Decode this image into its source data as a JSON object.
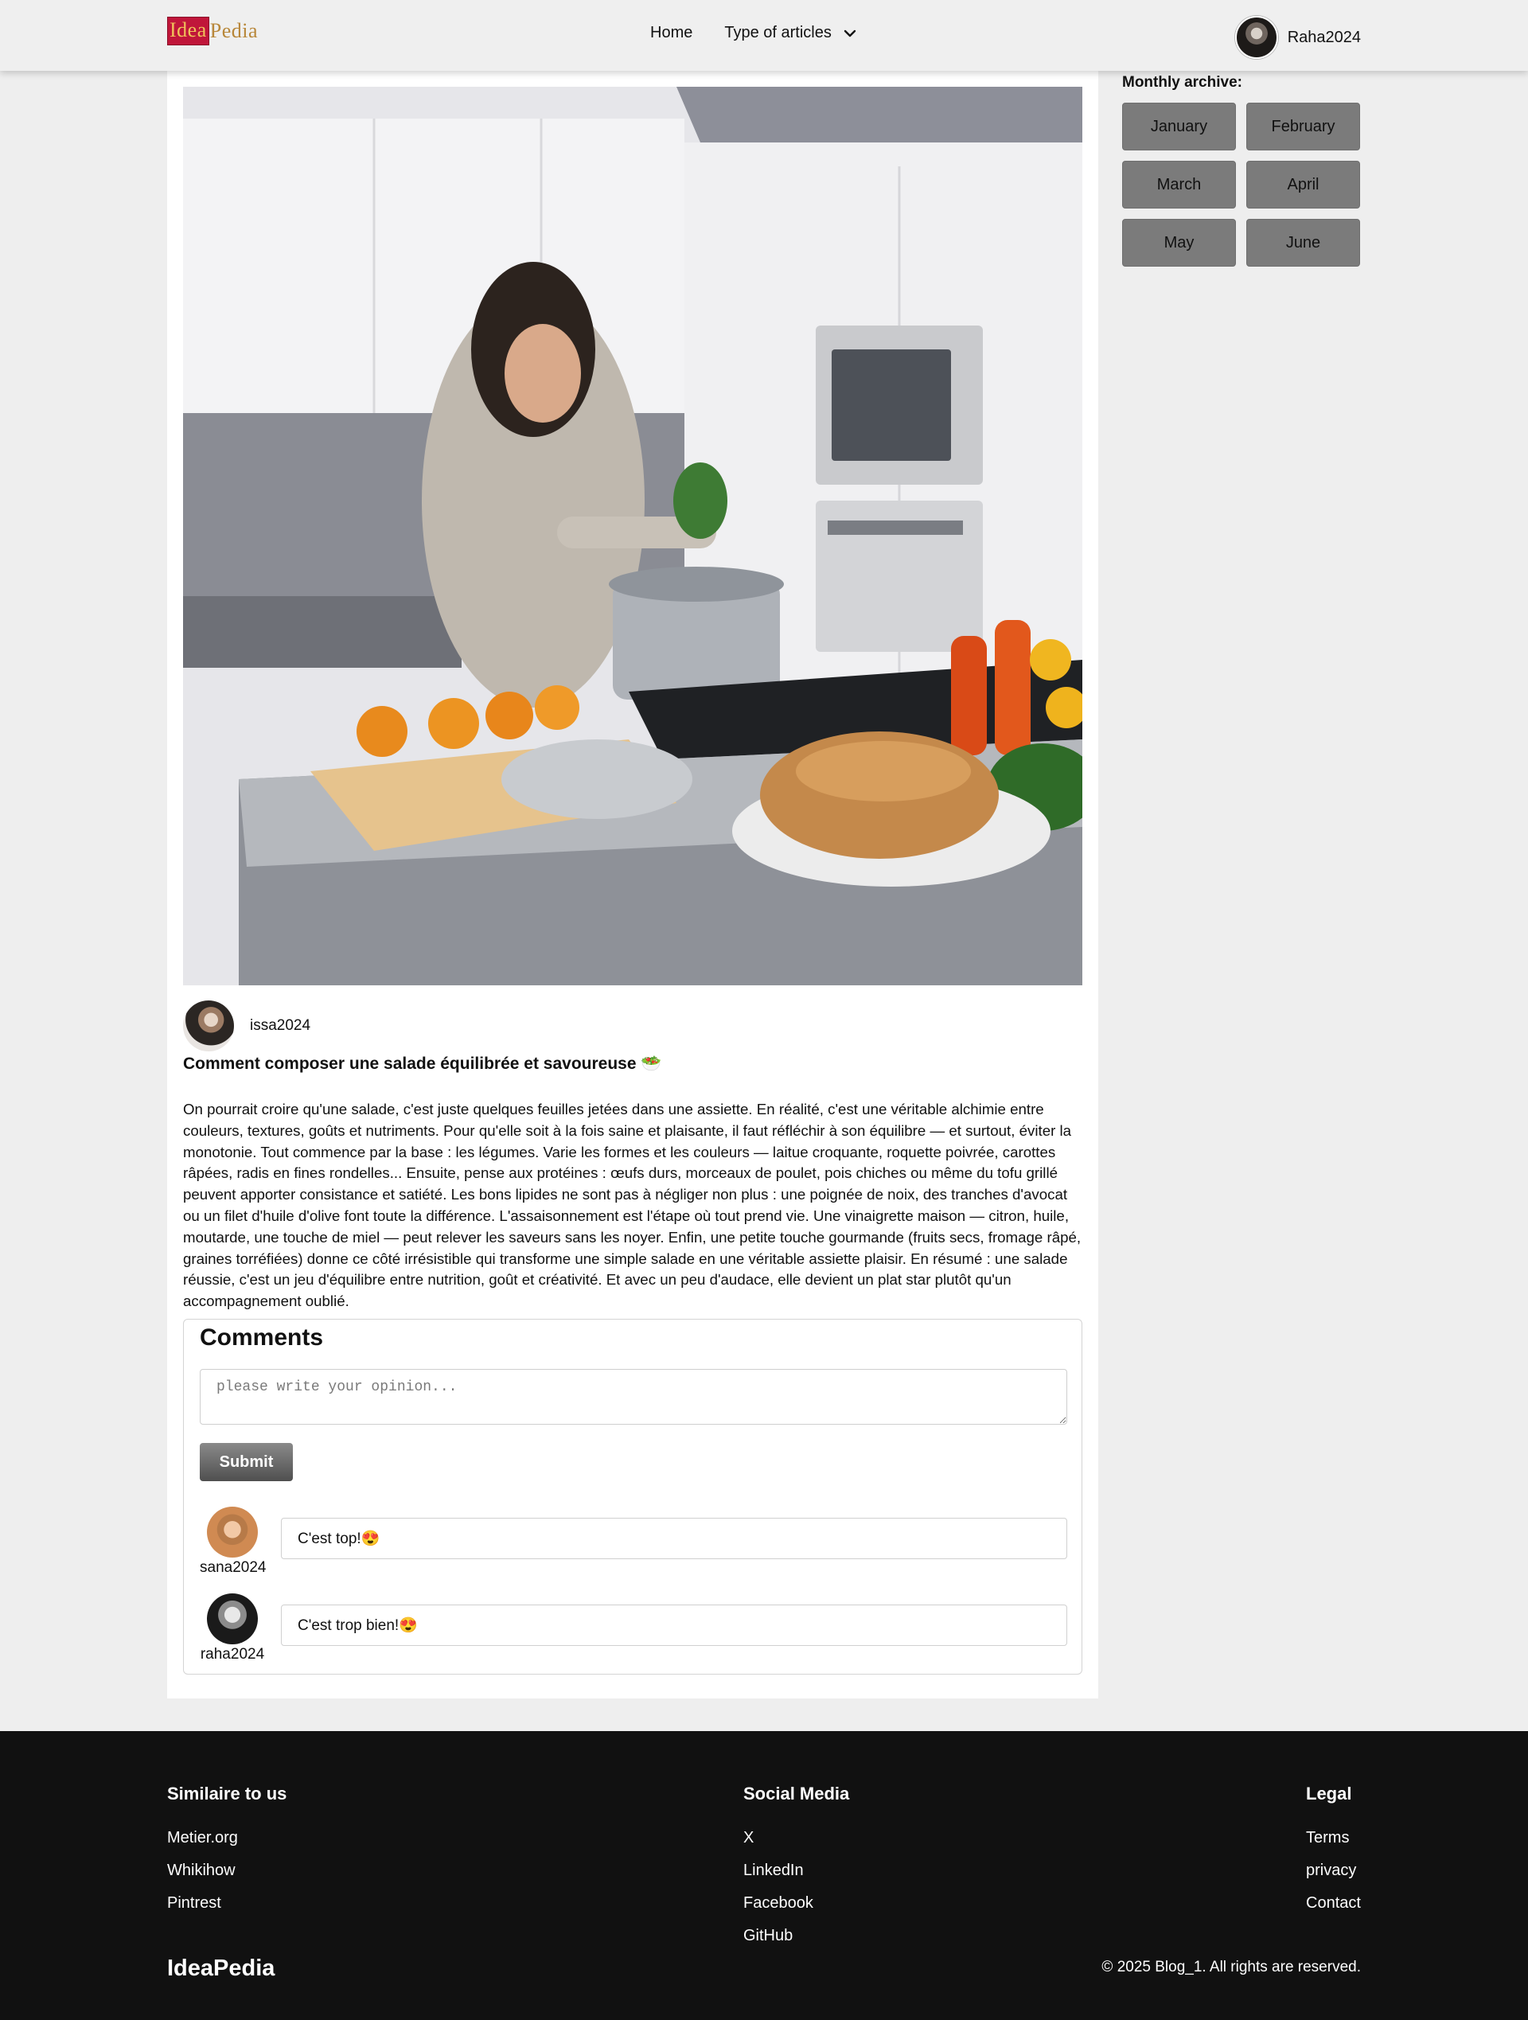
{
  "header": {
    "logo": {
      "part1": "Idea",
      "part2": "Pedia"
    },
    "nav": {
      "home": "Home",
      "types": "Type of articles"
    },
    "user": {
      "name": "Raha2024"
    }
  },
  "post": {
    "author": "issa2024",
    "title": "Comment composer une salade équilibrée et savoureuse 🥗",
    "body": "On pourrait croire qu'une salade, c'est juste quelques feuilles jetées dans une assiette. En réalité, c'est une véritable alchimie entre couleurs, textures, goûts et nutriments. Pour qu'elle soit à la fois saine et plaisante, il faut réfléchir à son équilibre — et surtout, éviter la monotonie. Tout commence par la base : les légumes. Varie les formes et les couleurs — laitue croquante, roquette poivrée, carottes râpées, radis en fines rondelles... Ensuite, pense aux protéines : œufs durs, morceaux de poulet, pois chiches ou même du tofu grillé peuvent apporter consistance et satiété. Les bons lipides ne sont pas à négliger non plus : une poignée de noix, des tranches d'avocat ou un filet d'huile d'olive font toute la différence. L'assaisonnement est l'étape où tout prend vie. Une vinaigrette maison — citron, huile, moutarde, une touche de miel — peut relever les saveurs sans les noyer. Enfin, une petite touche gourmande (fruits secs, fromage râpé, graines torréfiées) donne ce côté irrésistible qui transforme une simple salade en une véritable assiette plaisir. En résumé : une salade réussie, c'est un jeu d'équilibre entre nutrition, goût et créativité. Et avec un peu d'audace, elle devient un plat star plutôt qu'un accompagnement oublié."
  },
  "comments": {
    "heading": "Comments",
    "placeholder": "please write your opinion...",
    "submit": "Submit",
    "items": [
      {
        "user": "sana2024",
        "text": "C'est top!😍"
      },
      {
        "user": "raha2024",
        "text": "C'est trop bien!😍"
      }
    ]
  },
  "sidebar": {
    "title": "Monthly archive:",
    "months": [
      "January",
      "February",
      "March",
      "April",
      "May",
      "June"
    ]
  },
  "footer": {
    "similar": {
      "title": "Similaire to us",
      "links": [
        "Metier.org",
        "Whikihow",
        "Pintrest"
      ]
    },
    "social": {
      "title": "Social Media",
      "links": [
        "X",
        "LinkedIn",
        "Facebook",
        "GitHub"
      ]
    },
    "legal": {
      "title": "Legal",
      "links": [
        "Terms",
        "privacy",
        "Contact"
      ]
    },
    "brand": "IdeaPedia",
    "copyright": "© 2025 Blog_1. All rights are reserved."
  },
  "colors": {
    "page_bg": "#eeeeee",
    "footer_bg": "#111111",
    "archive_button": "#7b7b7b",
    "submit_button": "#5e5e5e",
    "logo_red": "#c0163a",
    "logo_gold": "#b8873a"
  }
}
